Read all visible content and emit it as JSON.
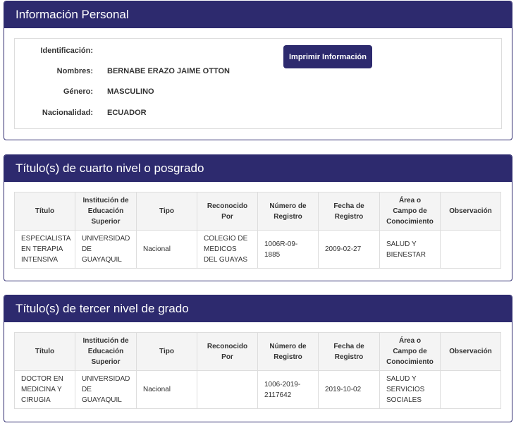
{
  "personal": {
    "title": "Información Personal",
    "fields": [
      {
        "label": "Identificación:",
        "value": ""
      },
      {
        "label": "Nombres:",
        "value": "BERNABE ERAZO JAIME OTTON"
      },
      {
        "label": "Género:",
        "value": "MASCULINO"
      },
      {
        "label": "Nacionalidad:",
        "value": "ECUADOR"
      }
    ],
    "print_label": "Imprimir Información"
  },
  "columns": [
    "Título",
    "Institución de Educación Superior",
    "Tipo",
    "Reconocido Por",
    "Número de Registro",
    "Fecha de Registro",
    "Área o Campo de Conocimiento",
    "Observación"
  ],
  "cuarto": {
    "title": "Título(s) de cuarto nivel o posgrado",
    "row": {
      "titulo": "ESPECIALISTA EN TERAPIA INTENSIVA",
      "institucion": "UNIVERSIDAD DE GUAYAQUIL",
      "tipo": "Nacional",
      "reconocido": "COLEGIO DE MEDICOS DEL GUAYAS",
      "numero": "1006R-09-1885",
      "fecha": "2009-02-27",
      "area": "SALUD Y BIENESTAR",
      "observacion": ""
    }
  },
  "tercer": {
    "title": "Título(s) de tercer nivel de grado",
    "row": {
      "titulo": "DOCTOR EN MEDICINA Y CIRUGIA",
      "institucion": "UNIVERSIDAD DE GUAYAQUIL",
      "tipo": "Nacional",
      "reconocido": "",
      "numero": "1006-2019-2117642",
      "fecha": "2019-10-02",
      "area": "SALUD Y SERVICIOS SOCIALES",
      "observacion": ""
    }
  }
}
